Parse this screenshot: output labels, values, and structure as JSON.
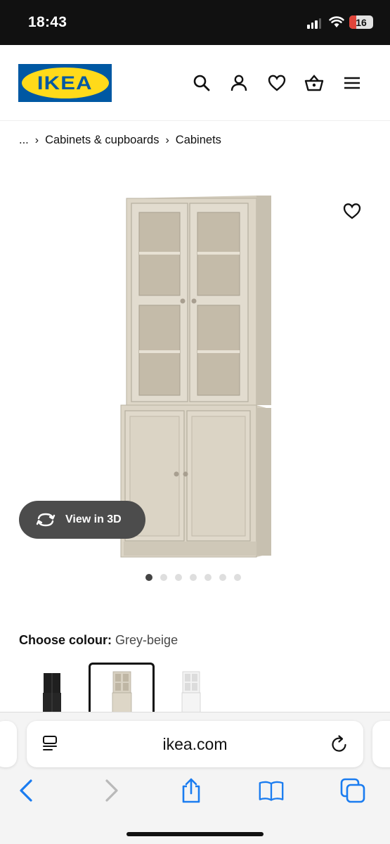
{
  "status_bar": {
    "time": "18:43",
    "battery": "16",
    "battery_color": "#e0453a"
  },
  "header": {
    "logo_text": "IKEA",
    "brand_blue": "#0058a3",
    "brand_yellow": "#ffda1a",
    "icons": [
      "search-icon",
      "profile-icon",
      "heart-icon",
      "basket-icon",
      "menu-icon"
    ]
  },
  "breadcrumb": {
    "items": [
      "...",
      "Cabinets & cupboards",
      "Cabinets"
    ],
    "separator": "›"
  },
  "product": {
    "view3d_label": "View in 3D",
    "image_count": 7,
    "active_image": 1,
    "colour_label": "Choose colour:",
    "colour_value": "Grey-beige",
    "swatches": [
      {
        "name": "black",
        "color": "#222222",
        "selected": false
      },
      {
        "name": "grey-beige",
        "color": "#cfc8b8",
        "selected": true
      },
      {
        "name": "white",
        "color": "#ececec",
        "selected": false
      }
    ]
  },
  "browser": {
    "url": "ikea.com",
    "toolbar_icons": [
      "back-icon",
      "forward-icon",
      "share-icon",
      "bookmarks-icon",
      "tabs-icon"
    ],
    "accent": "#1a7cf0"
  }
}
